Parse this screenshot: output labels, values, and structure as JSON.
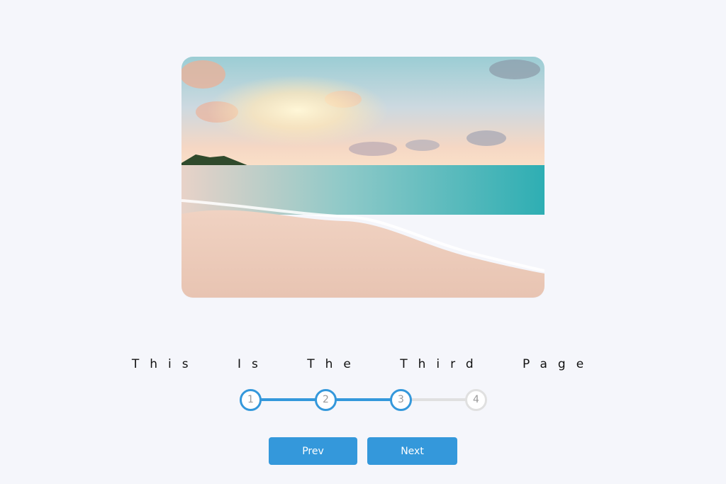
{
  "hero": {
    "image": "beach-sunset-photo"
  },
  "page": {
    "title": "This Is The Third Page"
  },
  "progress": {
    "current_step": 3,
    "total_steps": 4,
    "steps": [
      {
        "label": "1",
        "active": true
      },
      {
        "label": "2",
        "active": true
      },
      {
        "label": "3",
        "active": true
      },
      {
        "label": "4",
        "active": false
      }
    ]
  },
  "buttons": {
    "prev_label": "Prev",
    "next_label": "Next"
  },
  "colors": {
    "background": "#f5f6fb",
    "accent": "#3498db",
    "inactive": "#e0e0e0",
    "step_text": "#999999"
  }
}
